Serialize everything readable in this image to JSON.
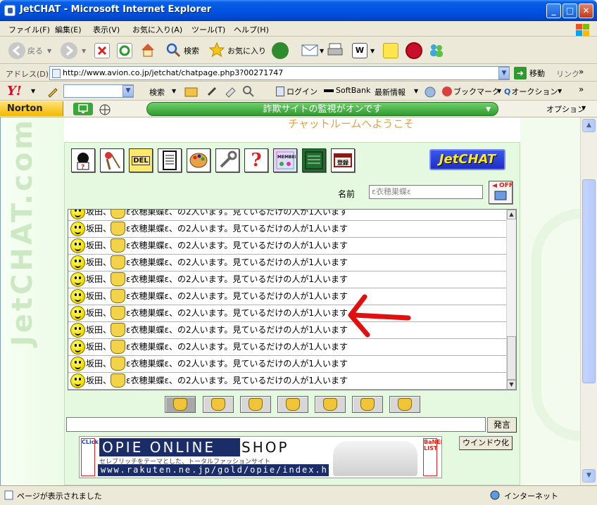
{
  "window": {
    "title": "JetCHAT - Microsoft Internet Explorer",
    "minimize": "_",
    "maximize": "□",
    "close": "✕"
  },
  "menu": [
    "ファイル(F)",
    "編集(E)",
    "表示(V)",
    "お気に入り(A)",
    "ツール(T)",
    "ヘルプ(H)"
  ],
  "toolbar": {
    "back": "戻る",
    "search": "検索",
    "favorites": "お気に入り"
  },
  "address": {
    "label": "アドレス(D)",
    "url": "http://www.avion.co.jp/jetchat/chatpage.php3?00271747",
    "go": "移動",
    "links": "リンク"
  },
  "yahoo": {
    "logo": "Y!",
    "search": "検索",
    "login": "ログイン",
    "softbank": "SoftBank",
    "news": "最新情報",
    "bookmark": "ブックマーク",
    "auction": "オークション"
  },
  "norton": {
    "brand": "Norton",
    "status": "詐欺サイトの監視がオンです",
    "options": "オプション"
  },
  "page": {
    "welcome": "チャットルームへようこそ",
    "watermark": "JetCHAT.com",
    "logo": "JetCHAT",
    "tool_icons": [
      "?",
      "♥",
      "DEL",
      "≡",
      "◉",
      "✂",
      "?",
      "MEMBER",
      "▤",
      "登録"
    ],
    "name_label": "名前",
    "name_value": "ε衣穂巣蝶ε",
    "off_label": "OFF",
    "log": {
      "prefix": "坂田、",
      "message": "ε衣穂巣蝶ε、の2人います。見ているだけの人が1人います",
      "line_count": 11
    },
    "send": "発言",
    "window_button": "ウインドウ化",
    "banner": {
      "click": "CLick",
      "top": "OPIE ONLINE",
      "shop": "SHOP",
      "sub": "セレブリッチをテーマとした、トータルファッションサイト",
      "url": "www.rakuten.ne.jp/gold/opie/index.html",
      "list": "BaNER LIST"
    }
  },
  "status": {
    "left": "ページが表示されました",
    "right": "インターネット"
  },
  "colors": {
    "title_blue": "#0054e3",
    "norton_green": "#3da53a",
    "arrow_red": "#e01010",
    "welcome_orange": "#e3a03b"
  }
}
